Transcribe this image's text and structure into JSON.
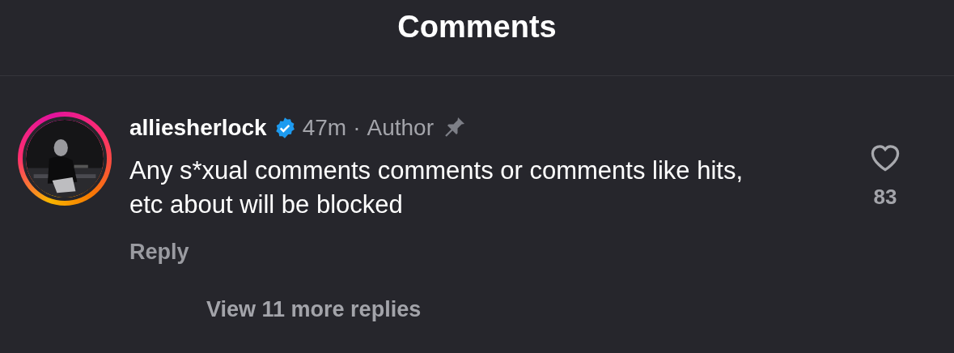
{
  "header": {
    "title": "Comments"
  },
  "comments": [
    {
      "username": "alliesherlock",
      "verified": true,
      "time": "47m",
      "separator": "·",
      "role": "Author",
      "pinned": true,
      "text": "Any s*xual comments comments or comments like hits, etc about will be blocked",
      "reply": "Reply",
      "liked": false,
      "likes": "83",
      "more_replies": "View 11 more replies",
      "has_story": true
    }
  ]
}
